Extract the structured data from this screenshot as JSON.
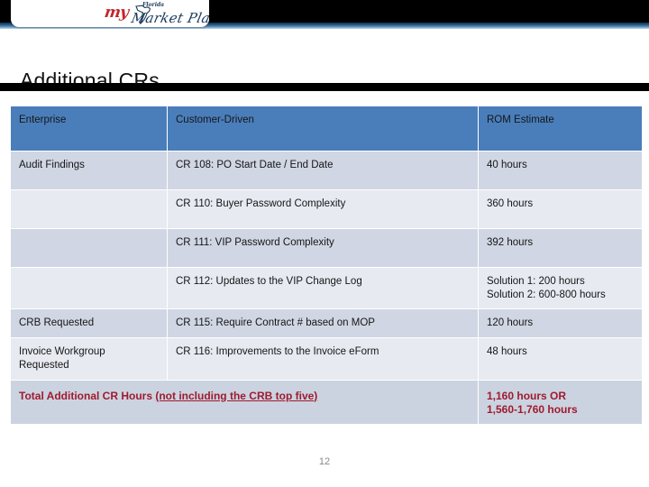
{
  "brand": {
    "logo_my": "my",
    "logo_florida": "Florida",
    "logo_marketplace": "Market Place",
    "logo_alt": "MyFloridaMarketPlace"
  },
  "slide": {
    "title": "Additional CRs",
    "page_number": "12"
  },
  "table": {
    "headers": [
      "Enterprise",
      "Customer-Driven",
      "ROM Estimate"
    ],
    "rows": [
      {
        "enterprise": "Audit Findings",
        "customer_driven": "CR 108: PO Start Date / End Date",
        "rom_estimate": "40 hours"
      },
      {
        "enterprise": "",
        "customer_driven": "CR 110: Buyer Password Complexity",
        "rom_estimate": "360 hours"
      },
      {
        "enterprise": "",
        "customer_driven": "CR 111: VIP Password Complexity",
        "rom_estimate": "392 hours"
      },
      {
        "enterprise": "",
        "customer_driven": "CR 112: Updates to the VIP Change Log",
        "rom_estimate_line1": "Solution 1: 200 hours",
        "rom_estimate_line2": "Solution 2: 600-800 hours"
      },
      {
        "enterprise": "CRB Requested",
        "customer_driven": "CR 115: Require Contract # based on MOP",
        "rom_estimate": "120 hours"
      },
      {
        "enterprise_line1": "Invoice Workgroup",
        "enterprise_line2": "Requested",
        "customer_driven": "CR 116: Improvements to the Invoice eForm",
        "rom_estimate": "48 hours"
      }
    ],
    "total": {
      "label_plain": "Total Additional CR Hours ",
      "label_underlined": "(not including the CRB top five)",
      "value_line1": "1,160 hours OR",
      "value_line2": "1,560-1,760  hours"
    }
  },
  "colors": {
    "header_blue": "#4a7ebb",
    "row_dark": "#d0d6e3",
    "row_light": "#e8eaf2",
    "total_red": "#9e1b2f",
    "banner_black": "#000000"
  }
}
